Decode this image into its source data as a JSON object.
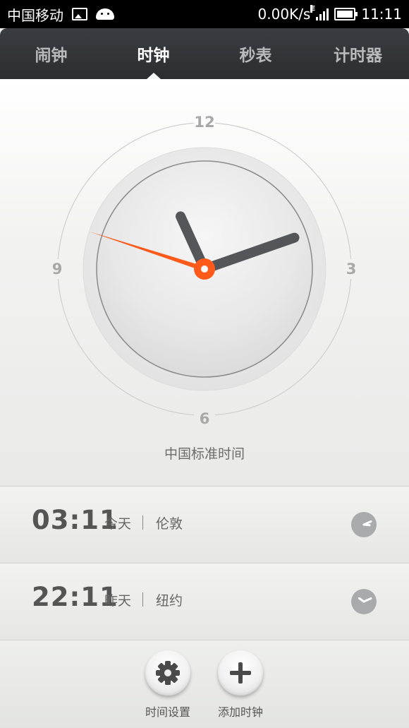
{
  "status_bar": {
    "carrier": "中国移动",
    "speed": "0.00K/s",
    "time": "11:11",
    "icons": [
      "image-icon",
      "android-icon",
      "signal-icon",
      "battery-icon"
    ]
  },
  "tabs": [
    {
      "label": "闹钟",
      "active": false
    },
    {
      "label": "时钟",
      "active": true
    },
    {
      "label": "秒表",
      "active": false
    },
    {
      "label": "计时器",
      "active": false
    }
  ],
  "clock": {
    "numerals": {
      "twelve": "12",
      "three": "3",
      "six": "6",
      "nine": "9"
    },
    "timezone_label": "中国标准时间",
    "hour": 11,
    "minute": 11,
    "second": 48,
    "accent_color": "#ff5a1a",
    "hand_color": "#555659"
  },
  "cities": [
    {
      "time": "03:11",
      "day": "今天",
      "name": "伦敦",
      "hour": 3,
      "minute": 11
    },
    {
      "time": "22:11",
      "day": "昨天",
      "name": "纽约",
      "hour": 22,
      "minute": 11
    }
  ],
  "actions": {
    "time_settings_label": "时间设置",
    "add_clock_label": "添加时钟"
  }
}
